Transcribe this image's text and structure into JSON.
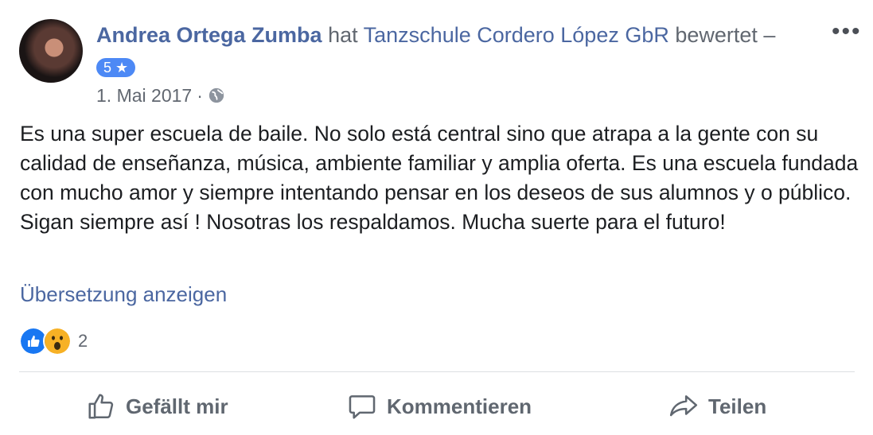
{
  "post": {
    "author_name": "Andrea Ortega Zumba",
    "verb": "hat",
    "page_name": "Tanzschule Cordero López GbR",
    "verb_end": "bewertet –",
    "more_label": "•••",
    "rating_label": "5 ★",
    "date": "1. Mai 2017",
    "separator": "·",
    "privacy_icon": "globe-icon",
    "text": "Es una super escuela de baile. No solo está central sino que atrapa a la gente con su calidad de enseñanza, música, ambiente familiar y amplia oferta. Es una escuela fundada con mucho amor y siempre intentando pensar en los deseos de sus alumnos y o público. Sigan siempre así ! Nosotras los respaldamos. Mucha suerte para el futuro!",
    "translate_label": "Übersetzung anzeigen"
  },
  "reactions": {
    "types": [
      "like-icon",
      "wow-icon"
    ],
    "count": "2"
  },
  "actions": {
    "like_label": "Gefällt mir",
    "comment_label": "Kommentieren",
    "share_label": "Teilen"
  },
  "colors": {
    "link": "#4b67a1",
    "badge": "#4d89f5",
    "like_blue": "#1877f2",
    "wow_yellow": "#f7b125",
    "muted": "#616770"
  }
}
